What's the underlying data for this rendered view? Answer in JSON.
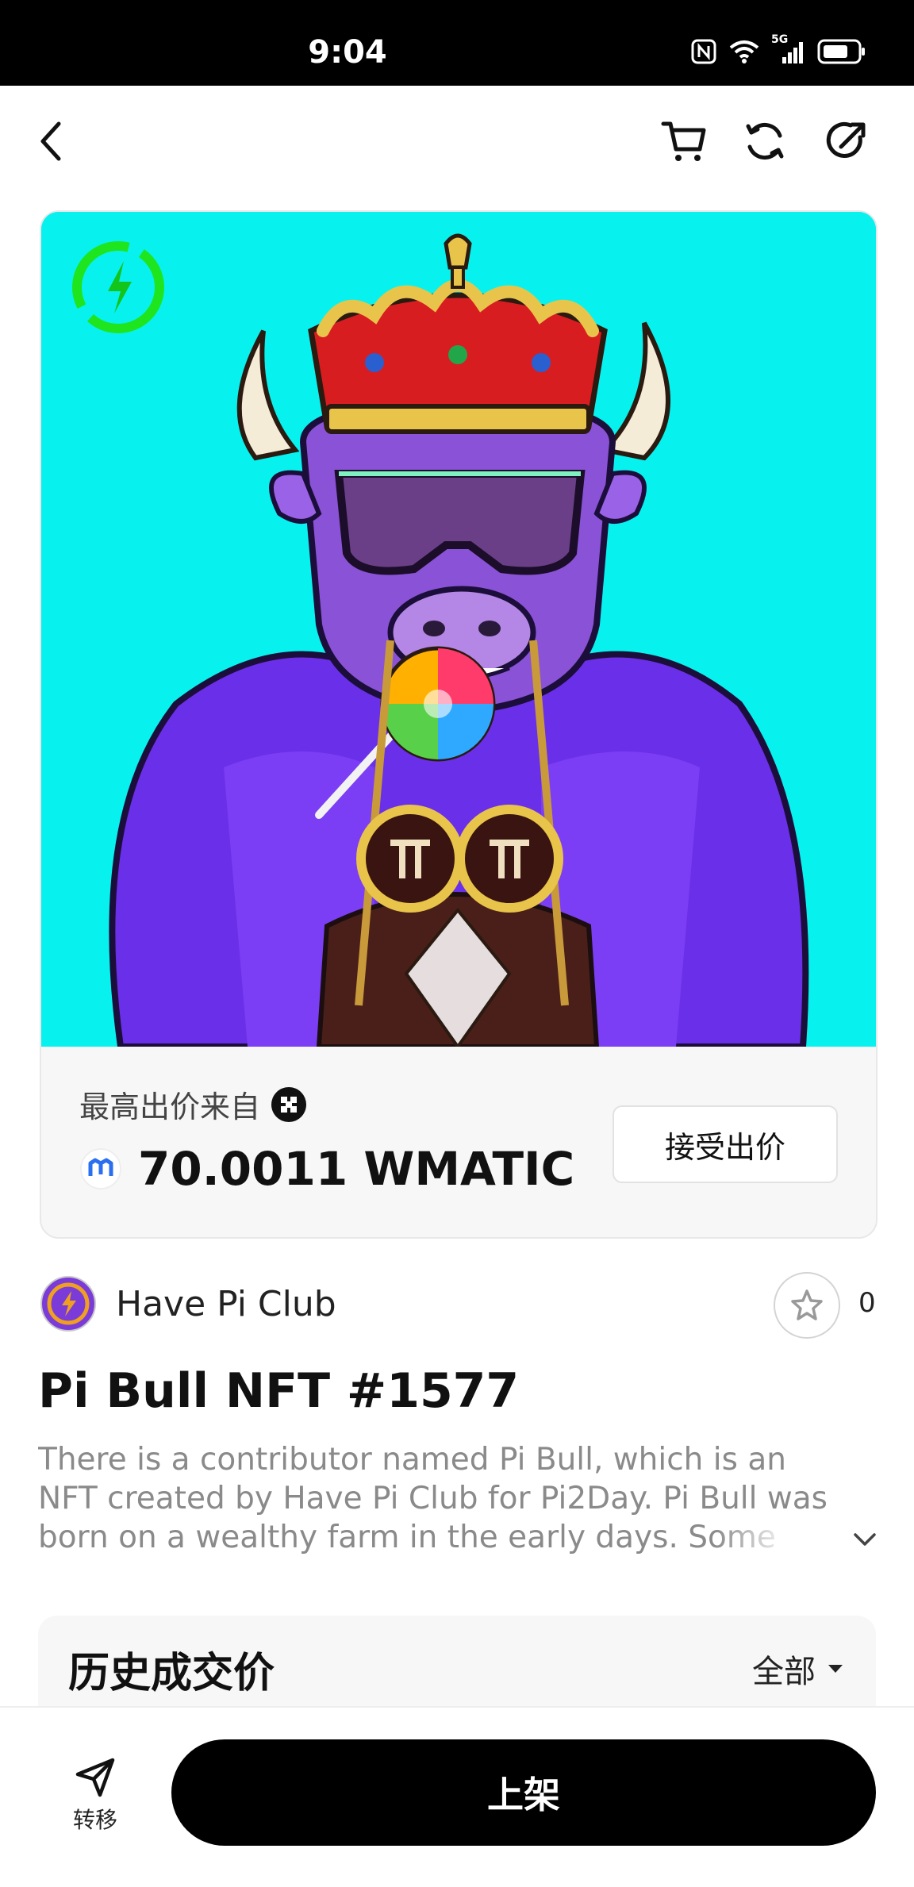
{
  "status_bar": {
    "time": "9:04",
    "network": "5G",
    "icons": [
      "nfc-icon",
      "wifi-icon",
      "signal-icon",
      "battery-icon"
    ]
  },
  "nav": {
    "icons": [
      "back-icon",
      "cart-icon",
      "refresh-icon",
      "share-icon"
    ]
  },
  "artwork": {
    "badge_icon": "lightning-badge-icon",
    "background_color": "#07f2ef",
    "subject": "purple bull NFT with crown, sunglasses, lollipop and cape"
  },
  "offer": {
    "label": "最高出价来自",
    "bidder_icon": "bidder-avatar-icon",
    "currency_icon": "polygon-matic-icon",
    "amount": "70.0011 WMATIC",
    "accept_label": "接受出价"
  },
  "collection": {
    "name": "Have Pi Club",
    "avatar_icon": "collection-avatar-icon",
    "favorite_icon": "star-icon",
    "favorite_count": "0"
  },
  "nft": {
    "title": "Pi Bull NFT #1577",
    "description": "There is a contributor named Pi Bull, which is an NFT created by Have Pi Club for Pi2Day.  Pi Bull was born on a wealthy farm in the early days. Some changes",
    "expand_icon": "chevron-down-icon"
  },
  "history": {
    "title": "历史成交价",
    "filter_label": "全部",
    "filter_icon": "caret-down-icon"
  },
  "bottom_bar": {
    "transfer_label": "转移",
    "transfer_icon": "send-icon",
    "list_label": "上架"
  },
  "colors": {
    "accent": "#000000",
    "badge_green": "#1ee51e",
    "art_background": "#07f2ef",
    "cape_purple": "#6a2fe8"
  }
}
